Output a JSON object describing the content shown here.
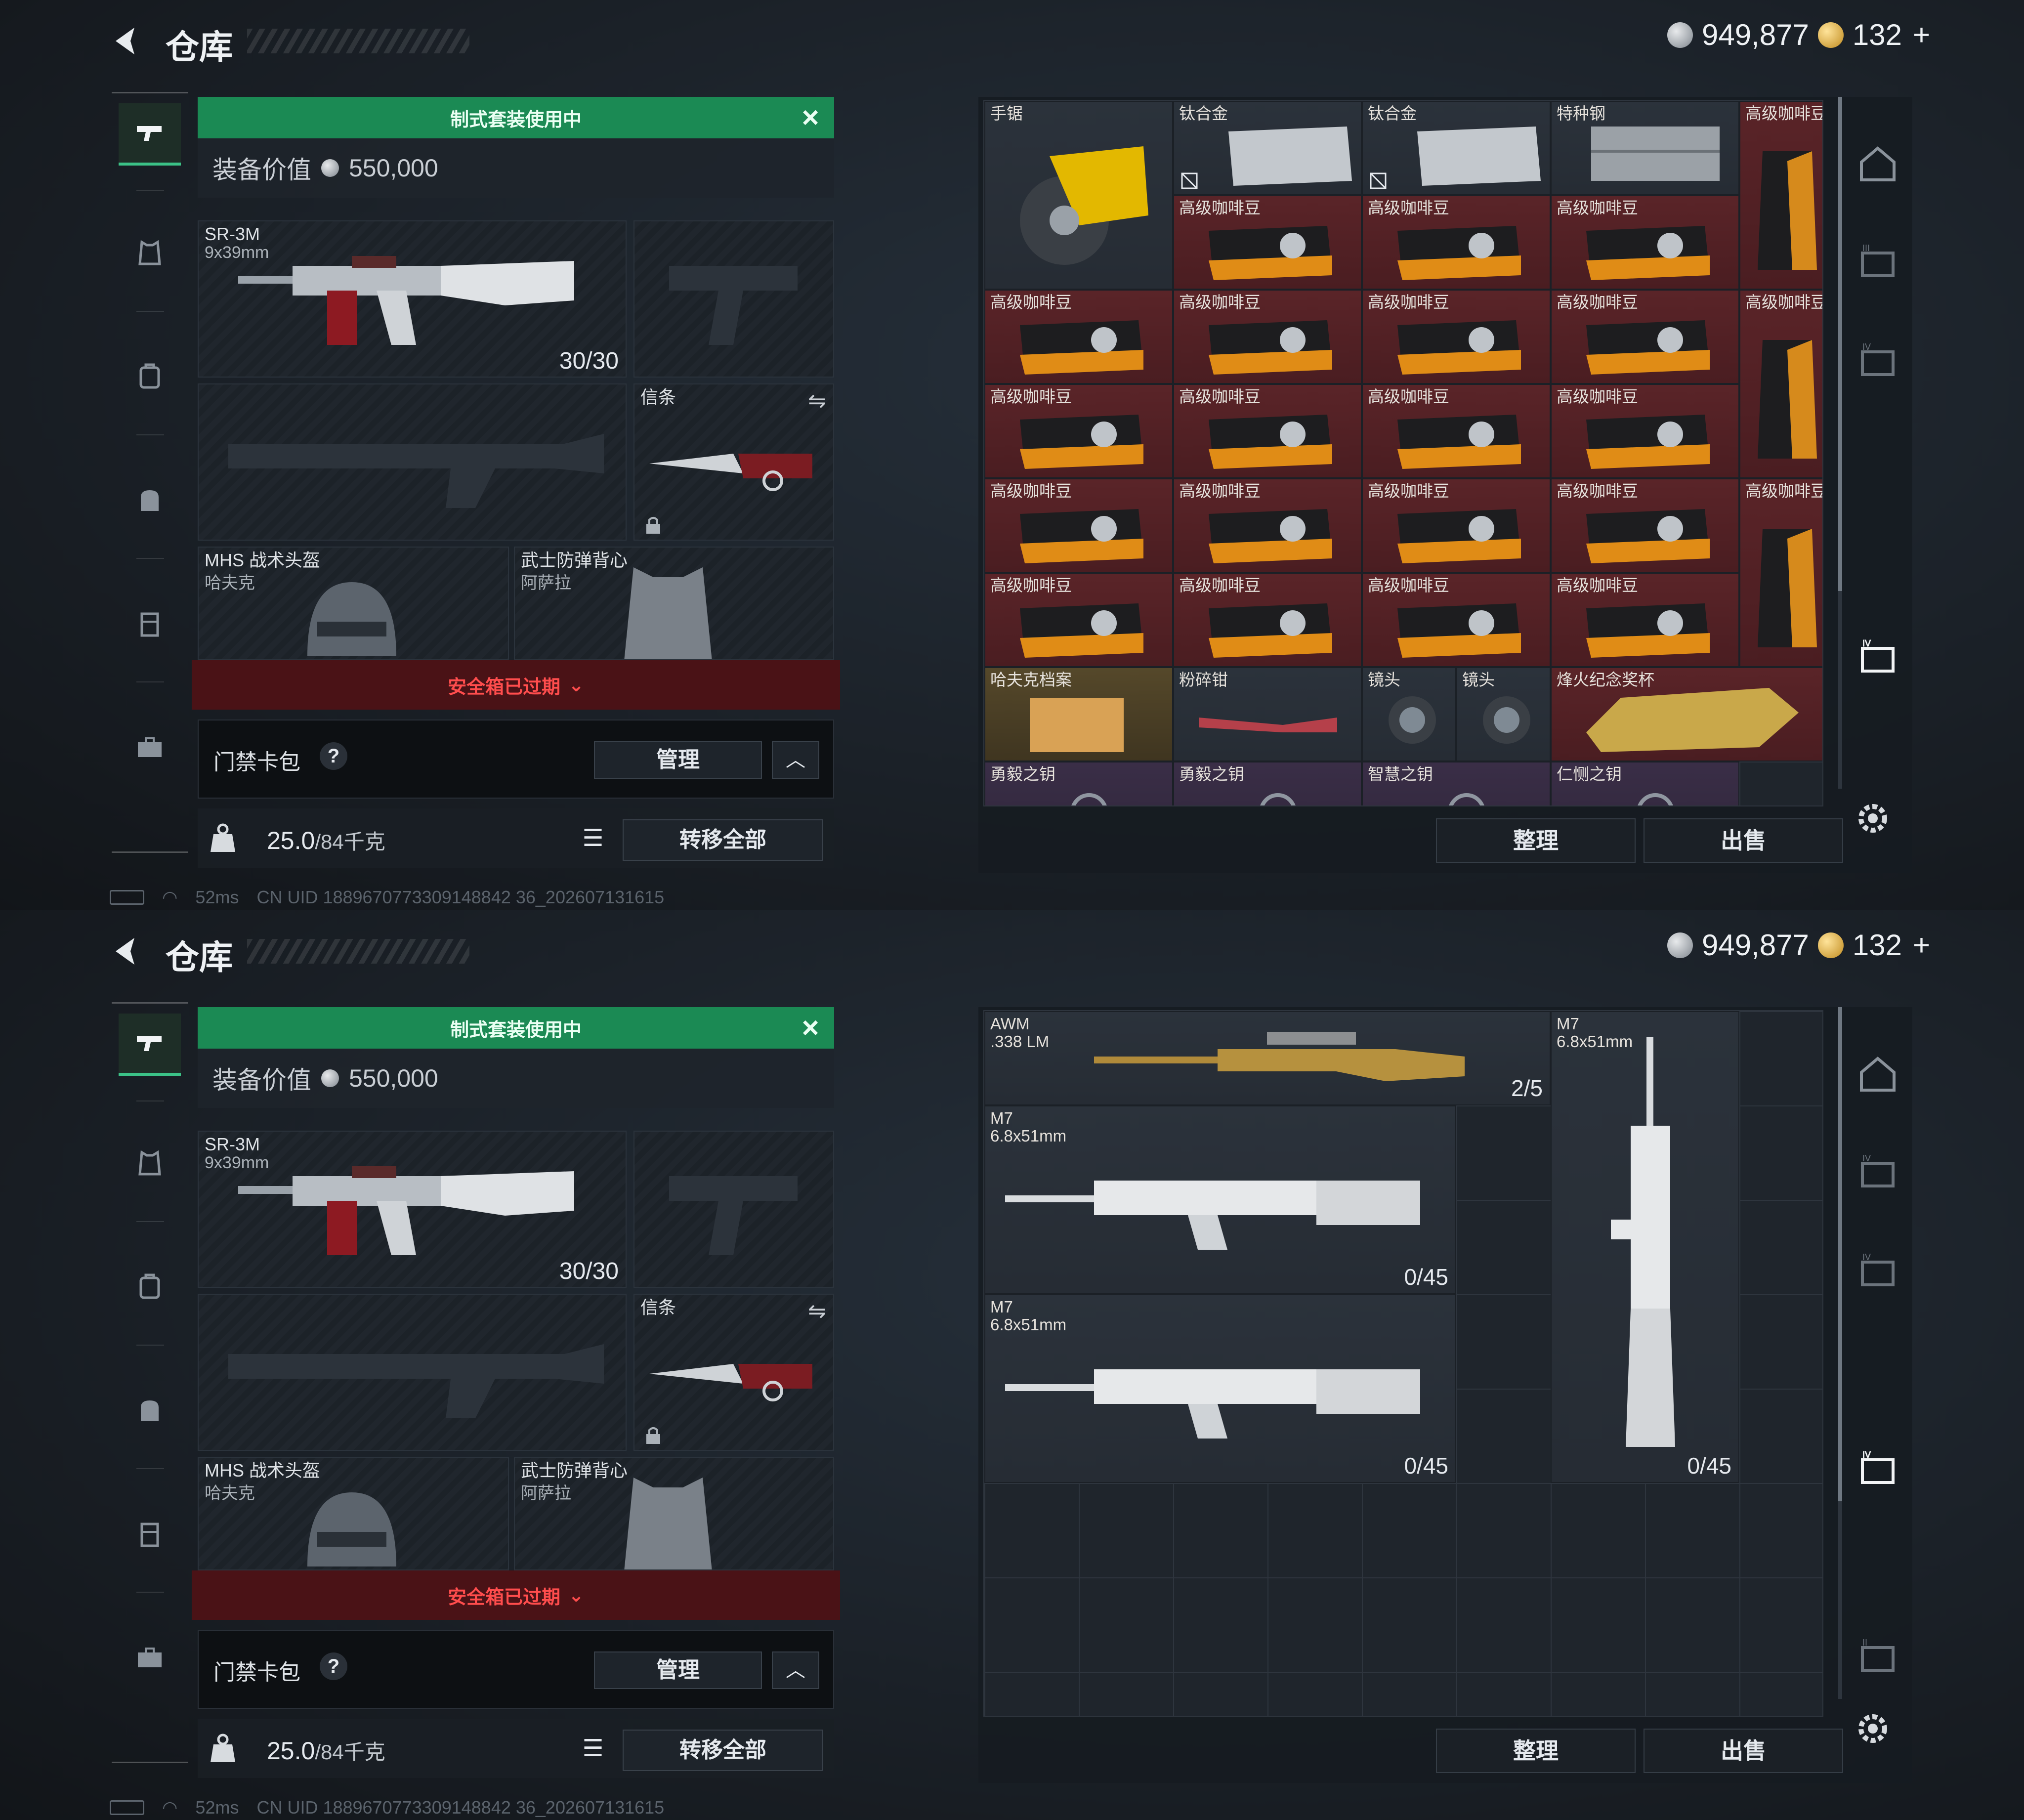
{
  "screens": [
    {
      "header": {
        "title": "仓库"
      },
      "currency": {
        "silver": "949,877",
        "gold": "132",
        "plus": "+"
      },
      "loadout": {
        "banner": "制式套装使用中",
        "value_label": "装备价值",
        "value": "550,000",
        "primary": {
          "name": "SR-3M",
          "caliber": "9x39mm",
          "ammo": "30/30"
        },
        "melee": {
          "name": "信条"
        },
        "helmet": {
          "name": "MHS 战术头盔",
          "sub": "哈夫克"
        },
        "armor": {
          "name": "武士防弹背心",
          "sub": "阿萨拉"
        },
        "safe_box": "安全箱已过期",
        "card_pack": "门禁卡包",
        "help": "?",
        "manage": "管理",
        "weight": "25.0",
        "weight_cap": "/84千克",
        "transfer_all": "转移全部"
      },
      "status": {
        "ping": "52ms",
        "uid": "CN UID 1889670773309148842 36_202607131615"
      },
      "storage": {
        "items_row0": [
          "手锯",
          "钛合金",
          "钛合金",
          "特种钢",
          "高级咖啡豆"
        ],
        "coffee": "高级咖啡豆",
        "row_special": [
          "哈夫克档案",
          "粉碎钳",
          "镜头",
          "镜头",
          "烽火纪念奖杯"
        ],
        "row_keys": [
          "勇毅之钥",
          "勇毅之钥",
          "智慧之钥",
          "仁恻之钥"
        ],
        "sort": "整理",
        "sell": "出售"
      }
    },
    {
      "header": {
        "title": "仓库"
      },
      "currency": {
        "silver": "949,877",
        "gold": "132",
        "plus": "+"
      },
      "loadout": {
        "banner": "制式套装使用中",
        "value_label": "装备价值",
        "value": "550,000",
        "primary": {
          "name": "SR-3M",
          "caliber": "9x39mm",
          "ammo": "30/30"
        },
        "melee": {
          "name": "信条"
        },
        "helmet": {
          "name": "MHS 战术头盔",
          "sub": "哈夫克"
        },
        "armor": {
          "name": "武士防弹背心",
          "sub": "阿萨拉"
        },
        "safe_box": "安全箱已过期",
        "card_pack": "门禁卡包",
        "help": "?",
        "manage": "管理",
        "weight": "25.0",
        "weight_cap": "/84千克",
        "transfer_all": "转移全部"
      },
      "status": {
        "ping": "52ms",
        "uid": "CN UID 1889670773309148842 36_202607131615"
      },
      "storage": {
        "weapons": [
          {
            "name": "AWM",
            "caliber": ".338 LM",
            "ammo": "2/5"
          },
          {
            "name": "M7",
            "caliber": "6.8x51mm",
            "ammo": "0/45"
          },
          {
            "name": "M7",
            "caliber": "6.8x51mm",
            "ammo": "0/45"
          },
          {
            "name": "M7",
            "caliber": "6.8x51mm",
            "ammo": "0/45"
          }
        ],
        "sort": "整理",
        "sell": "出售"
      }
    }
  ],
  "colors": {
    "accent_green": "#1b8a54",
    "alert_red": "#ff4d4d",
    "rare_red": "#5a2428",
    "rare_gold": "#55482a"
  },
  "icons": [
    "back-arrow-icon",
    "silver-coin-icon",
    "gold-coin-icon",
    "pistol-icon",
    "armor-icon",
    "bag-icon",
    "backpack-icon",
    "container-icon",
    "briefcase-icon",
    "lock-icon",
    "list-icon",
    "gear-icon",
    "help-icon",
    "chevron-up-icon",
    "swap-icon",
    "no-sell-icon"
  ]
}
